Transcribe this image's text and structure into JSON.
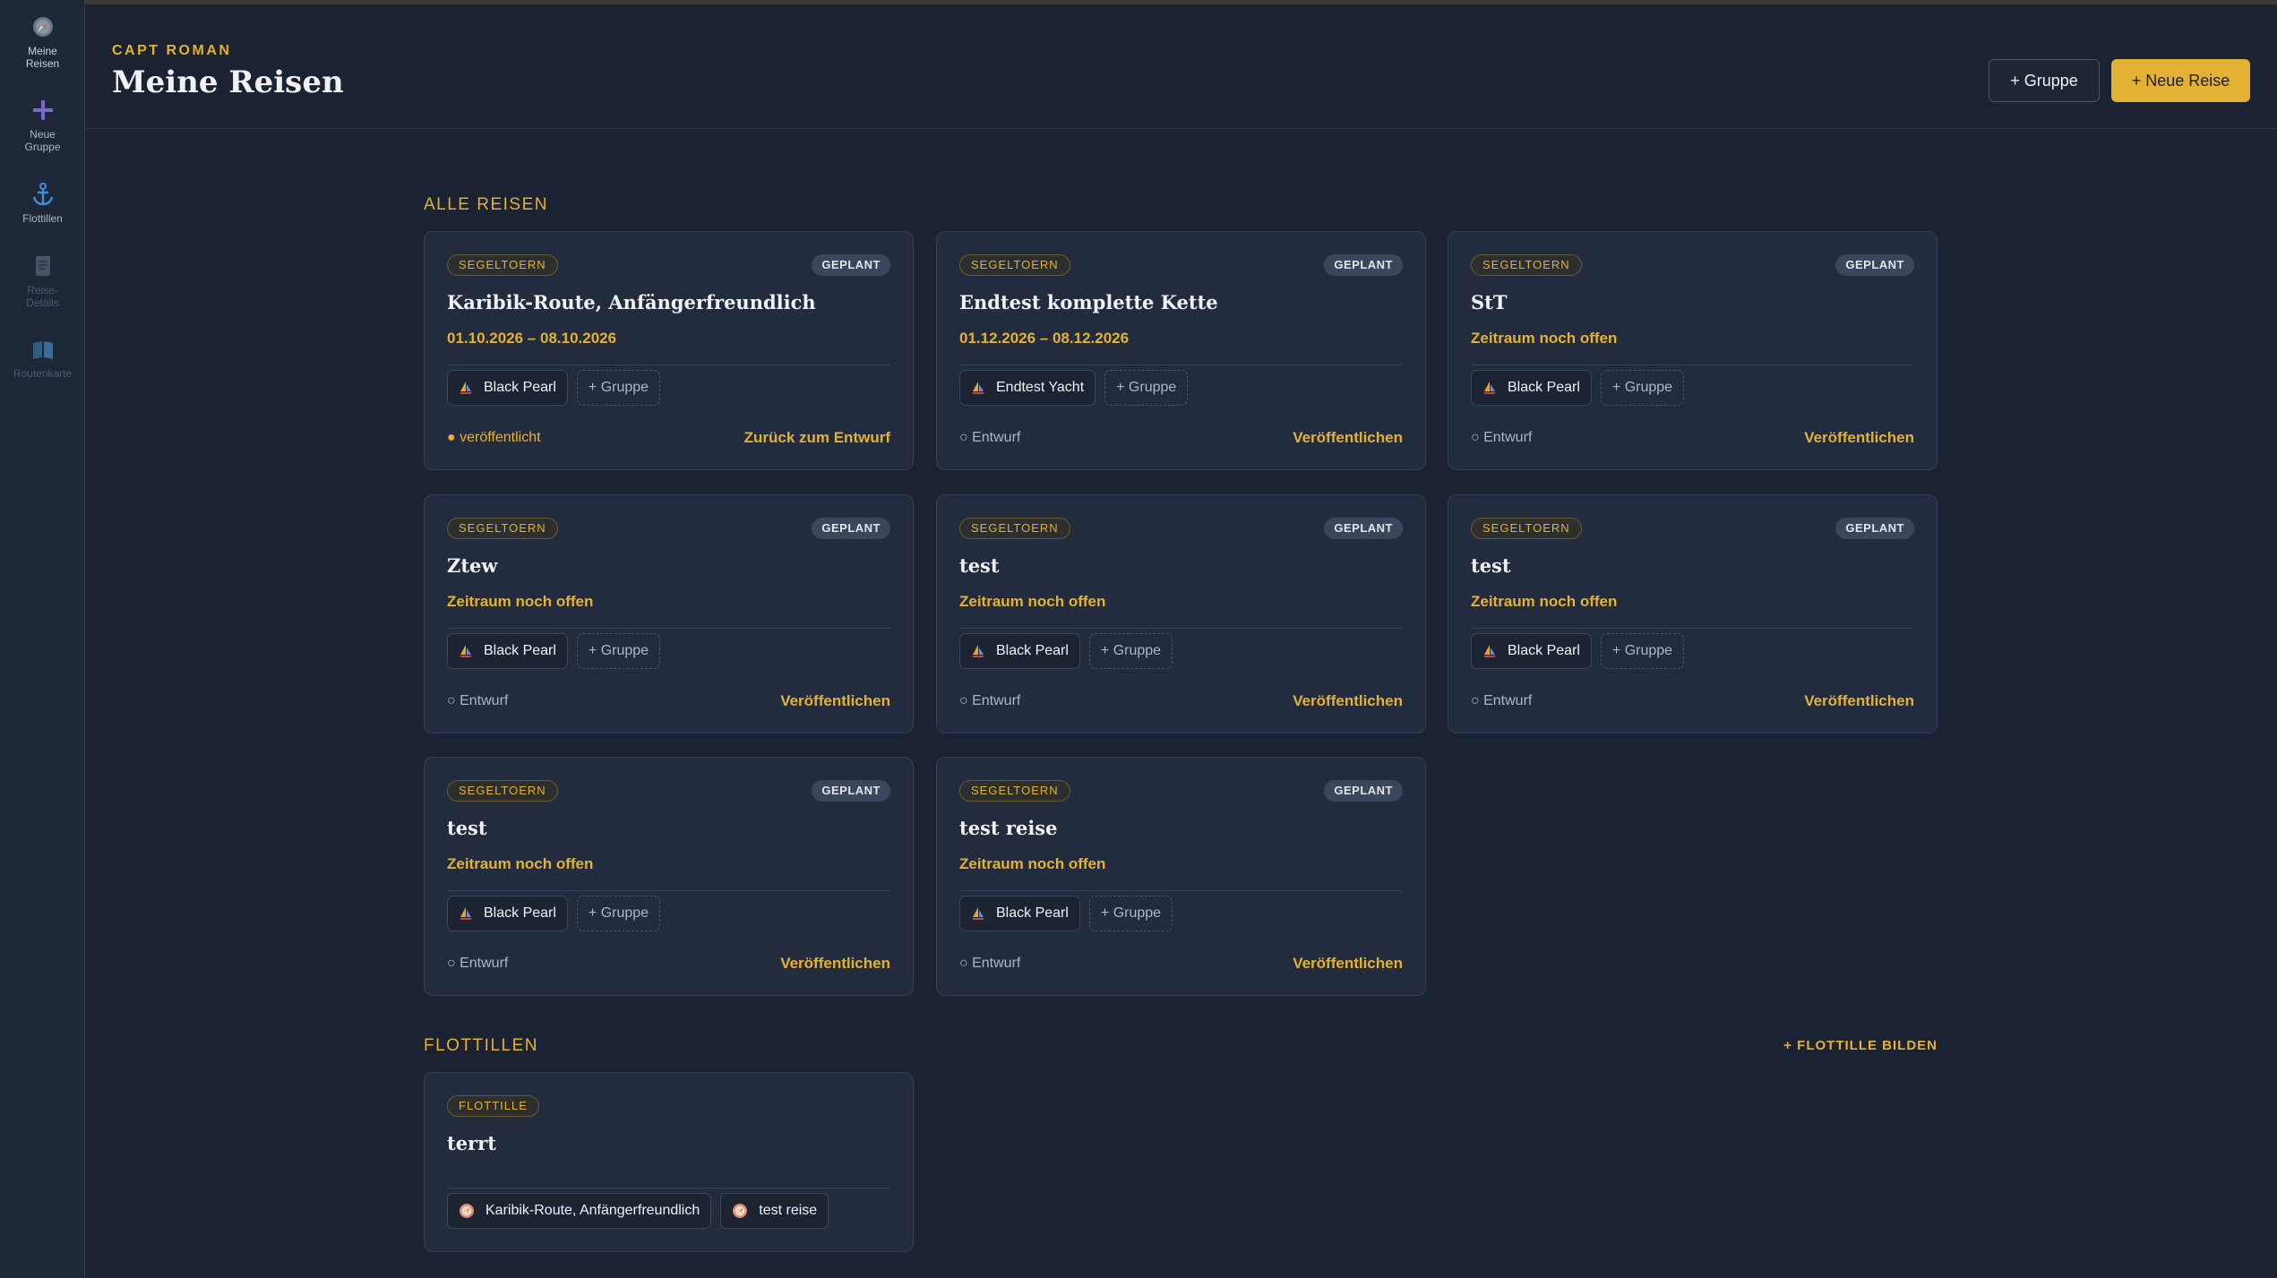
{
  "sidebar": {
    "items": [
      {
        "label_line1": "Meine",
        "label_line2": "Reisen",
        "icon": "compass-icon",
        "state": "active"
      },
      {
        "label_line1": "Neue",
        "label_line2": "Gruppe",
        "icon": "plus-icon",
        "state": "normal"
      },
      {
        "label_line1": "Flottillen",
        "label_line2": "",
        "icon": "anchor-icon",
        "state": "normal"
      },
      {
        "label_line1": "Reise-",
        "label_line2": "Details",
        "icon": "document-icon",
        "state": "disabled"
      },
      {
        "label_line1": "Routenkarte",
        "label_line2": "",
        "icon": "map-book-icon",
        "state": "disabled"
      }
    ]
  },
  "header": {
    "eyebrow": "CAPT ROMAN",
    "title": "Meine Reisen",
    "group_button": "+ Gruppe",
    "new_trip_button": "+ Neue Reise"
  },
  "trips_section": {
    "title": "ALLE REISEN",
    "cards": [
      {
        "type": "SEGELTOERN",
        "status": "GEPLANT",
        "title": "Karibik-Route, Anfängerfreundlich",
        "dates": "01.10.2026 – 08.10.2026",
        "boat": "Black Pearl",
        "add_group": "+ Gruppe",
        "pub_state": "● veröffentlicht",
        "action": "Zurück zum Entwurf"
      },
      {
        "type": "SEGELTOERN",
        "status": "GEPLANT",
        "title": "Endtest komplette Kette",
        "dates": "01.12.2026 – 08.12.2026",
        "boat": "Endtest Yacht",
        "add_group": "+ Gruppe",
        "pub_state": "○ Entwurf",
        "action": "Veröffentlichen"
      },
      {
        "type": "SEGELTOERN",
        "status": "GEPLANT",
        "title": "StT",
        "dates": "Zeitraum noch offen",
        "boat": "Black Pearl",
        "add_group": "+ Gruppe",
        "pub_state": "○ Entwurf",
        "action": "Veröffentlichen"
      },
      {
        "type": "SEGELTOERN",
        "status": "GEPLANT",
        "title": "Ztew",
        "dates": "Zeitraum noch offen",
        "boat": "Black Pearl",
        "add_group": "+ Gruppe",
        "pub_state": "○ Entwurf",
        "action": "Veröffentlichen"
      },
      {
        "type": "SEGELTOERN",
        "status": "GEPLANT",
        "title": "test",
        "dates": "Zeitraum noch offen",
        "boat": "Black Pearl",
        "add_group": "+ Gruppe",
        "pub_state": "○ Entwurf",
        "action": "Veröffentlichen"
      },
      {
        "type": "SEGELTOERN",
        "status": "GEPLANT",
        "title": "test",
        "dates": "Zeitraum noch offen",
        "boat": "Black Pearl",
        "add_group": "+ Gruppe",
        "pub_state": "○ Entwurf",
        "action": "Veröffentlichen"
      },
      {
        "type": "SEGELTOERN",
        "status": "GEPLANT",
        "title": "test",
        "dates": "Zeitraum noch offen",
        "boat": "Black Pearl",
        "add_group": "+ Gruppe",
        "pub_state": "○ Entwurf",
        "action": "Veröffentlichen"
      },
      {
        "type": "SEGELTOERN",
        "status": "GEPLANT",
        "title": "test reise",
        "dates": "Zeitraum noch offen",
        "boat": "Black Pearl",
        "add_group": "+ Gruppe",
        "pub_state": "○ Entwurf",
        "action": "Veröffentlichen"
      }
    ]
  },
  "flotillas_section": {
    "title": "FLOTTILLEN",
    "action": "+ FLOTTILLE BILDEN",
    "cards": [
      {
        "type": "FLOTTILLE",
        "title": "terrt",
        "trips": [
          "Karibik-Route, Anfängerfreundlich",
          "test reise"
        ]
      }
    ]
  },
  "colors": {
    "accent": "#e3b234",
    "background": "#1b2232",
    "card": "#222c3e"
  }
}
